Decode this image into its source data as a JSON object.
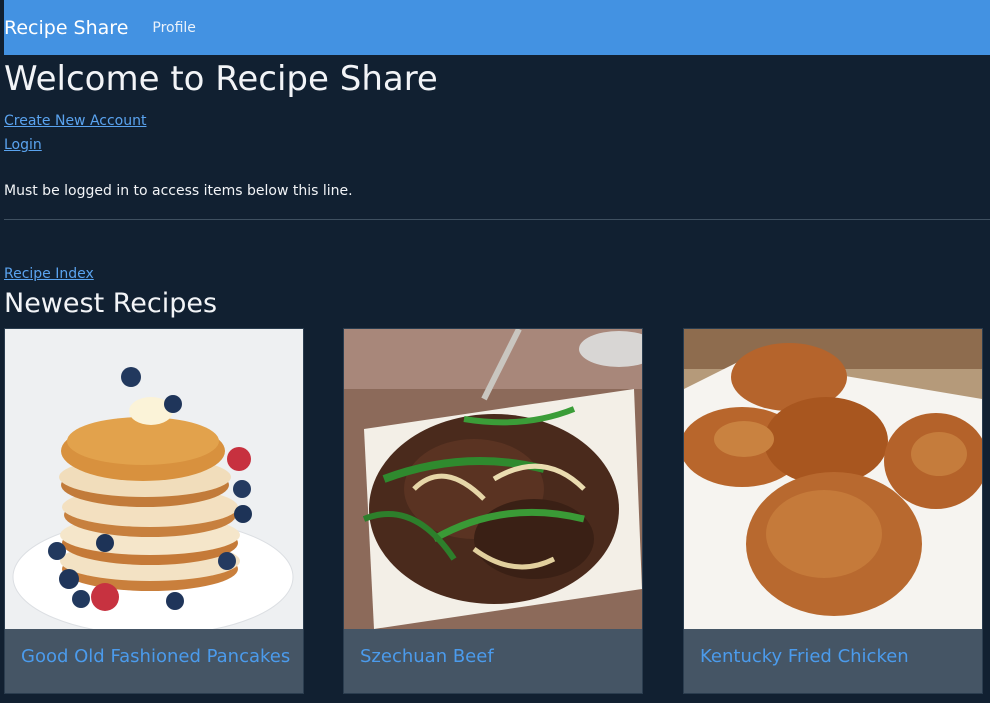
{
  "navbar": {
    "brand": "Recipe Share",
    "profile_link": "Profile",
    "color": "#4392e2"
  },
  "main": {
    "title": "Welcome to Recipe Share",
    "create_account_link": "Create New Account",
    "login_link": "Login",
    "notice": "Must be logged in to access items below this line.",
    "recipe_index_link": "Recipe Index",
    "newest_heading": "Newest Recipes"
  },
  "recipes": [
    {
      "title": "Good Old Fashioned Pancakes",
      "image": "pancakes-photo"
    },
    {
      "title": "Szechuan Beef",
      "image": "beef-stir-fry-photo"
    },
    {
      "title": "Kentucky Fried Chicken",
      "image": "fried-chicken-photo"
    }
  ],
  "colors": {
    "background": "#112031",
    "link": "#5aa3ef",
    "card_footer": "#455565"
  }
}
